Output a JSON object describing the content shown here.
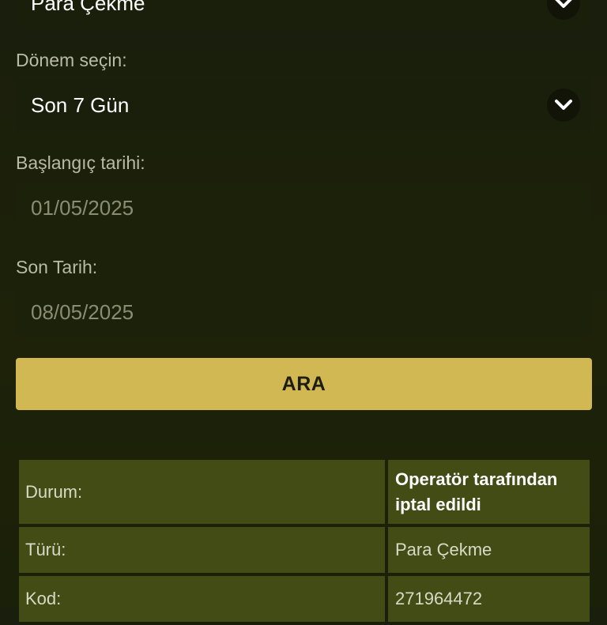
{
  "transaction_type_select": {
    "value": "Para Çekme"
  },
  "period": {
    "label": "Dönem seçin:",
    "value": "Son 7 Gün"
  },
  "start_date": {
    "label": "Başlangıç tarihi:",
    "value": "01/05/2025"
  },
  "end_date": {
    "label": "Son Tarih:",
    "value": "08/05/2025"
  },
  "search_button": {
    "label": "ARA"
  },
  "results": {
    "rows": [
      {
        "key": "Durum:",
        "value": "Operatör tarafından iptal edildi"
      },
      {
        "key": "Türü:",
        "value": "Para Çekme"
      },
      {
        "key": "Kod:",
        "value": "271964472"
      }
    ]
  },
  "colors": {
    "accent": "#d2b853",
    "background": "#1b2008",
    "table_cell": "#434c14"
  },
  "icons": {
    "dropdown": "chevron-down-icon"
  }
}
